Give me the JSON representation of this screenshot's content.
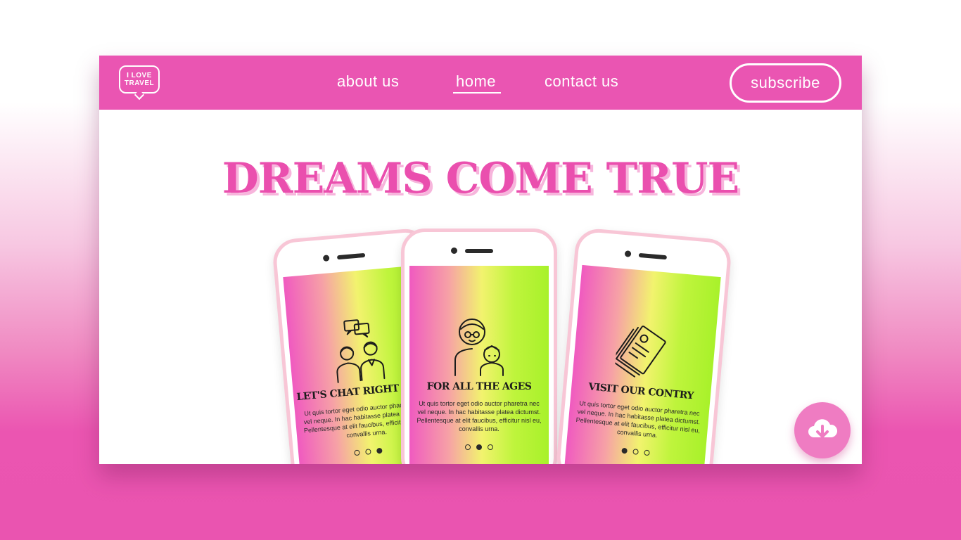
{
  "header": {
    "logo": {
      "line1": "I LOVE",
      "line2": "TRAVEL"
    },
    "nav": [
      {
        "label": "about us"
      },
      {
        "label": "home"
      },
      {
        "label": "contact us"
      }
    ],
    "active_nav": "home",
    "subscribe_label": "subscribe"
  },
  "hero": {
    "headline": "DREAMS COME TRUE"
  },
  "phones": [
    {
      "title": "LET'S CHAT RIGHT NOW",
      "body": "Ut quis tortor eget odio auctor pharetra nec vel neque. In hac habitasse platea dictumst. Pellentesque at elit faucibus, efficitur nisl eu, convallis urna.",
      "icon": "chat-people-icon",
      "dots": [
        false,
        false,
        true
      ]
    },
    {
      "title": "FOR ALL THE AGES",
      "body": "Ut quis tortor eget odio auctor pharetra nec vel neque. In hac habitasse platea dictumst. Pellentesque at elit faucibus, efficitur nisl eu, convallis urna.",
      "icon": "family-icon",
      "dots": [
        false,
        true,
        false
      ]
    },
    {
      "title": "VISIT OUR CONTRY",
      "body": "Ut quis tortor eget odio auctor pharetra nec vel neque. In hac habitasse platea dictumst. Pellentesque at elit faucibus, efficitur nisl eu, convallis urna.",
      "icon": "tickets-icon",
      "dots": [
        true,
        false,
        false
      ]
    }
  ],
  "fab": {
    "icon": "cloud-download-icon"
  },
  "colors": {
    "brand_pink": "#ea55b2",
    "headline_pink": "#ea4fae",
    "screen_gradient": [
      "#f05ac0",
      "#f2f36e",
      "#a8f12a"
    ]
  }
}
